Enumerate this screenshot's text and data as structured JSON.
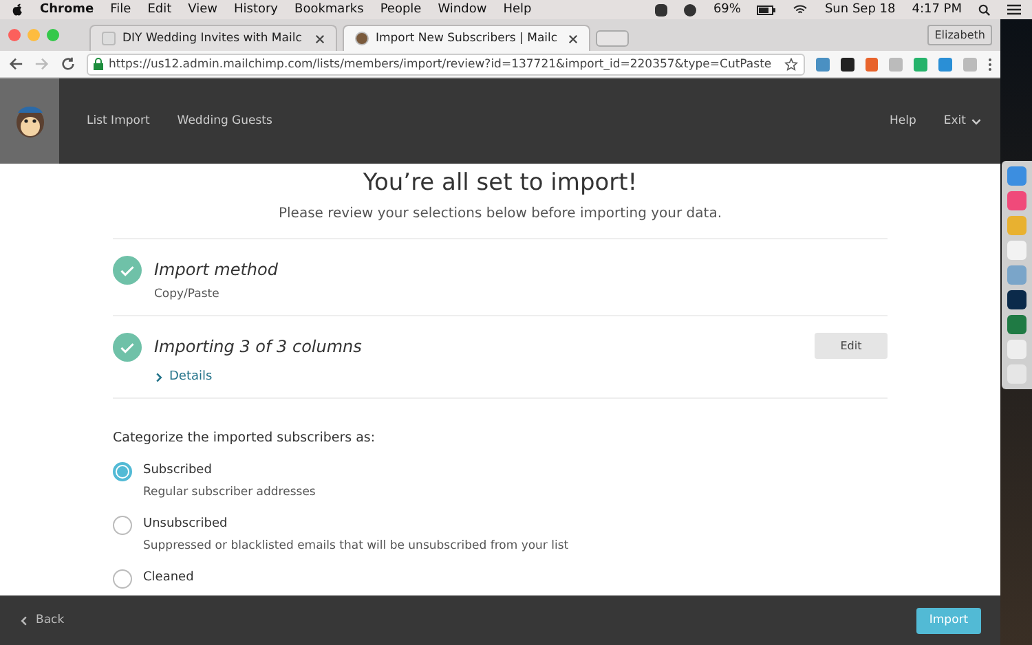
{
  "menubar": {
    "app": "Chrome",
    "menus": [
      "File",
      "Edit",
      "View",
      "History",
      "Bookmarks",
      "People",
      "Window",
      "Help"
    ],
    "battery": "69%",
    "date": "Sun Sep 18",
    "time": "4:17 PM"
  },
  "tabs": [
    {
      "label": "DIY Wedding Invites with Mailc",
      "selected": false
    },
    {
      "label": "Import New Subscribers | Mailc",
      "selected": true
    }
  ],
  "profile": "Elizabeth",
  "url": "https://us12.admin.mailchimp.com/lists/members/import/review?id=137721&import_id=220357&type=CutPaste",
  "nav": {
    "left": [
      "List Import",
      "Wedding Guests"
    ],
    "help": "Help",
    "exit": "Exit"
  },
  "title": "You’re all set to import!",
  "subtitle": "Please review your selections below before importing your data.",
  "steps": [
    {
      "title": "Import method",
      "detail": "Copy/Paste",
      "done": true
    },
    {
      "title": "Importing 3 of 3 columns",
      "link": "Details",
      "button": "Edit",
      "done": true
    }
  ],
  "categorize": {
    "label": "Categorize the imported subscribers as:",
    "options": [
      {
        "label": "Subscribed",
        "description": "Regular subscriber addresses",
        "selected": true
      },
      {
        "label": "Unsubscribed",
        "description": "Suppressed or blacklisted emails that will be unsubscribed from your list",
        "selected": false
      },
      {
        "label": "Cleaned",
        "selected": false
      }
    ]
  },
  "footer": {
    "back": "Back",
    "import": "Import"
  }
}
